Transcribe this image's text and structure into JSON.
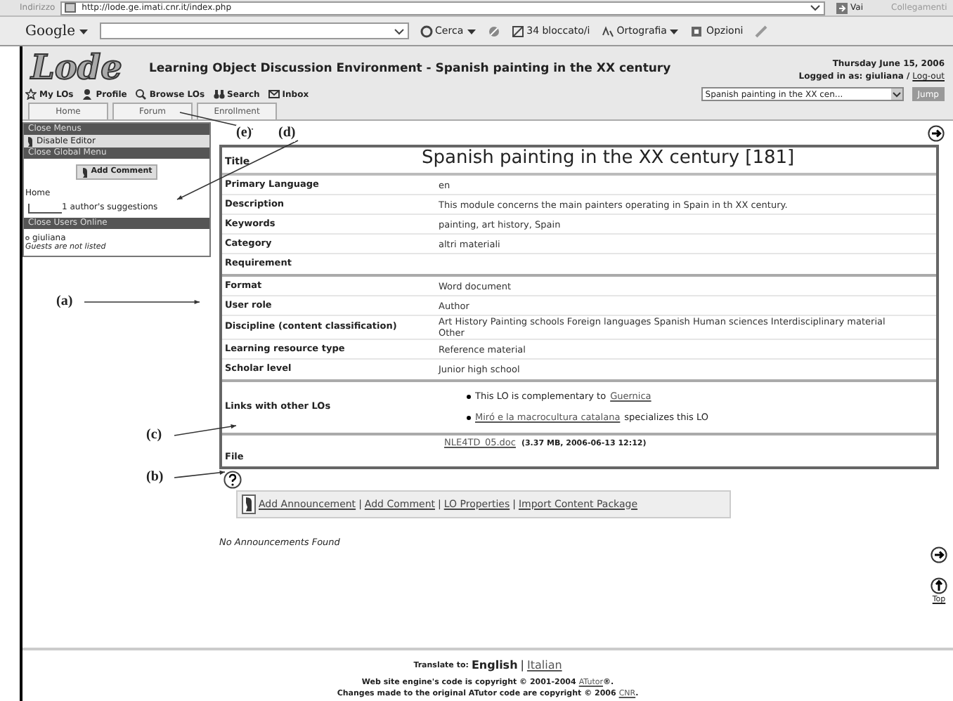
{
  "browser": {
    "address_label": "Indirizzo",
    "url": "http://lode.ge.imati.cnr.it/index.php",
    "go_button": "Vai",
    "links_label": "Collegamenti"
  },
  "google_toolbar": {
    "brand": "Google",
    "search_button": "Cerca",
    "blocked": "34 bloccato/i",
    "spellcheck": "Ortografia",
    "options": "Opzioni"
  },
  "header": {
    "logo": "Lode",
    "title": "Learning Object Discussion Environment - Spanish painting in the XX century",
    "date": "Thursday June 15, 2006",
    "logged_in": "Logged in as: giuliana /",
    "logout": "Log-out"
  },
  "nav": [
    {
      "label": "My LOs",
      "kind": "star"
    },
    {
      "label": "Profile",
      "kind": "person"
    },
    {
      "label": "Browse LOs",
      "kind": "browse"
    },
    {
      "label": "Search",
      "kind": "binoculars"
    },
    {
      "label": "Inbox",
      "kind": "mail"
    }
  ],
  "lo_select": {
    "value": "Spanish painting in the XX cen...",
    "button": "Jump"
  },
  "tabs": [
    {
      "label": "Home"
    },
    {
      "label": "Forum"
    },
    {
      "label": "Enrollment"
    }
  ],
  "sidebar": {
    "menus_header": "Close Menus",
    "disable_editor": "Disable Editor",
    "global_menu_header": "Close Global Menu",
    "add_comment": "Add Comment",
    "tree": {
      "label": "Home",
      "children": [
        {
          "label": "1 author's suggestions"
        }
      ]
    },
    "users_header": "Close Users Online",
    "users": [
      "giuliana"
    ],
    "guests_note": "Guests are not listed"
  },
  "lo_table": {
    "title_label": "Title",
    "title": "Spanish painting in the XX century  [181]",
    "sections": [
      [
        {
          "label": "Primary Language",
          "value": "en"
        },
        {
          "label": "Description",
          "value": "This module concerns the main painters operating in Spain in th XX century."
        },
        {
          "label": "Keywords",
          "value": "painting, art history, Spain"
        },
        {
          "label": "Category",
          "value": "altri materiali"
        },
        {
          "label": "Requirement"
        }
      ],
      [
        {
          "label": "Format",
          "value": "Word document"
        },
        {
          "label": "User role",
          "value": "Author"
        },
        {
          "label": "Discipline (content classification)",
          "value": "Art  History  Painting schools  Foreign languages  Spanish  Human sciences  Interdisciplinary material  Other"
        },
        {
          "label": "Learning resource type",
          "value": "Reference material"
        },
        {
          "label": "Scholar level",
          "value": "Junior high school"
        }
      ],
      [
        {
          "label": "Links with other LOs",
          "links": [
            {
              "before": "This LO is complementary to",
              "link": "Guernica"
            },
            {
              "link": "Miró e la macrocultura catalana",
              "after": "specializes  this LO"
            }
          ]
        }
      ],
      [
        {
          "label": "File",
          "file": "NLE4TD_05.doc",
          "info": "(3.37 MB, 2006-06-13 12:12)"
        }
      ]
    ]
  },
  "actions": [
    "Add Announcement",
    "Add Comment",
    "LO Properties",
    "Import Content Package"
  ],
  "separator": "|",
  "announcements_note": "No Announcements Found",
  "top_link": "Top",
  "footer": {
    "translate_label": "Translate to:",
    "current_language": "English",
    "other_language": "Italian",
    "lines": [
      {
        "text": "Web site engine's code is copyright © 2001-2004",
        "link": "ATutor",
        "after": "®."
      },
      {
        "text": "Changes made to the original ATutor code are copyright © 2006",
        "link": "CNR",
        "after": "."
      }
    ]
  },
  "annotations": [
    "(e)",
    "(d)",
    "(a)",
    "(c)",
    "(b)"
  ]
}
